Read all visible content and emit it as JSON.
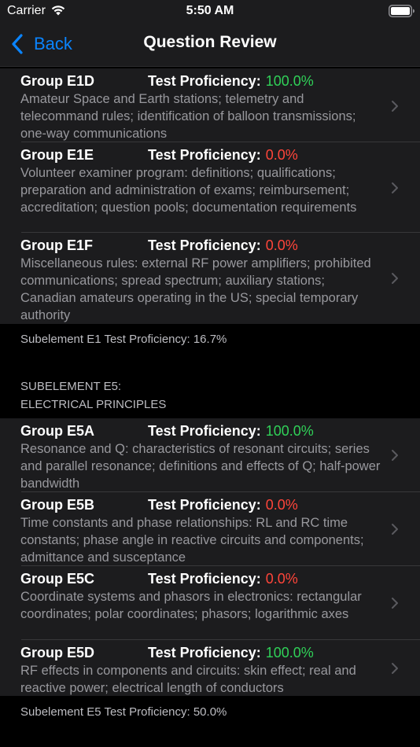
{
  "status_bar": {
    "carrier": "Carrier",
    "time": "5:50 AM"
  },
  "nav": {
    "back_label": "Back",
    "title": "Question Review"
  },
  "colors": {
    "good": "#30d158",
    "bad": "#ff453a",
    "accent": "#0a84ff"
  },
  "section_e1": {
    "groups": [
      {
        "group": "Group E1D",
        "prof_label": "Test Proficiency:",
        "prof_value": "100.0%",
        "description": "Amateur Space and Earth stations; telemetry and telecommand rules; identification of balloon transmissions; one-way communications"
      },
      {
        "group": "Group E1E",
        "prof_label": "Test Proficiency:",
        "prof_value": "0.0%",
        "description": "Volunteer examiner program: definitions; qualifications; preparation and administration of exams; reimbursement; accreditation; question pools; documentation requirements"
      },
      {
        "group": "Group E1F",
        "prof_label": "Test Proficiency:",
        "prof_value": "0.0%",
        "description": "Miscellaneous rules: external RF power amplifiers; prohibited communications; spread spectrum; auxiliary stations; Canadian amateurs operating in the US; special temporary authority"
      }
    ],
    "footer": "Subelement E1 Test Proficiency:  16.7%"
  },
  "section_e5": {
    "header_line1": "SUBELEMENT E5:",
    "header_line2": "ELECTRICAL PRINCIPLES",
    "groups": [
      {
        "group": "Group E5A",
        "prof_label": "Test Proficiency:",
        "prof_value": "100.0%",
        "description": "Resonance and Q: characteristics of resonant circuits; series and parallel resonance; definitions and effects of Q; half-power bandwidth"
      },
      {
        "group": "Group E5B",
        "prof_label": "Test Proficiency:",
        "prof_value": "0.0%",
        "description": "Time constants and phase relationships: RL and RC time constants; phase angle in reactive circuits and components; admittance and susceptance"
      },
      {
        "group": "Group E5C",
        "prof_label": "Test Proficiency:",
        "prof_value": "0.0%",
        "description": "Coordinate systems and phasors in electronics: rectangular coordinates; polar coordinates; phasors; logarithmic axes"
      },
      {
        "group": "Group E5D",
        "prof_label": "Test Proficiency:",
        "prof_value": "100.0%",
        "description": "RF effects in components and circuits: skin effect; real and reactive power; electrical length of conductors"
      }
    ],
    "footer": "Subelement E5 Test Proficiency:  50.0%"
  }
}
